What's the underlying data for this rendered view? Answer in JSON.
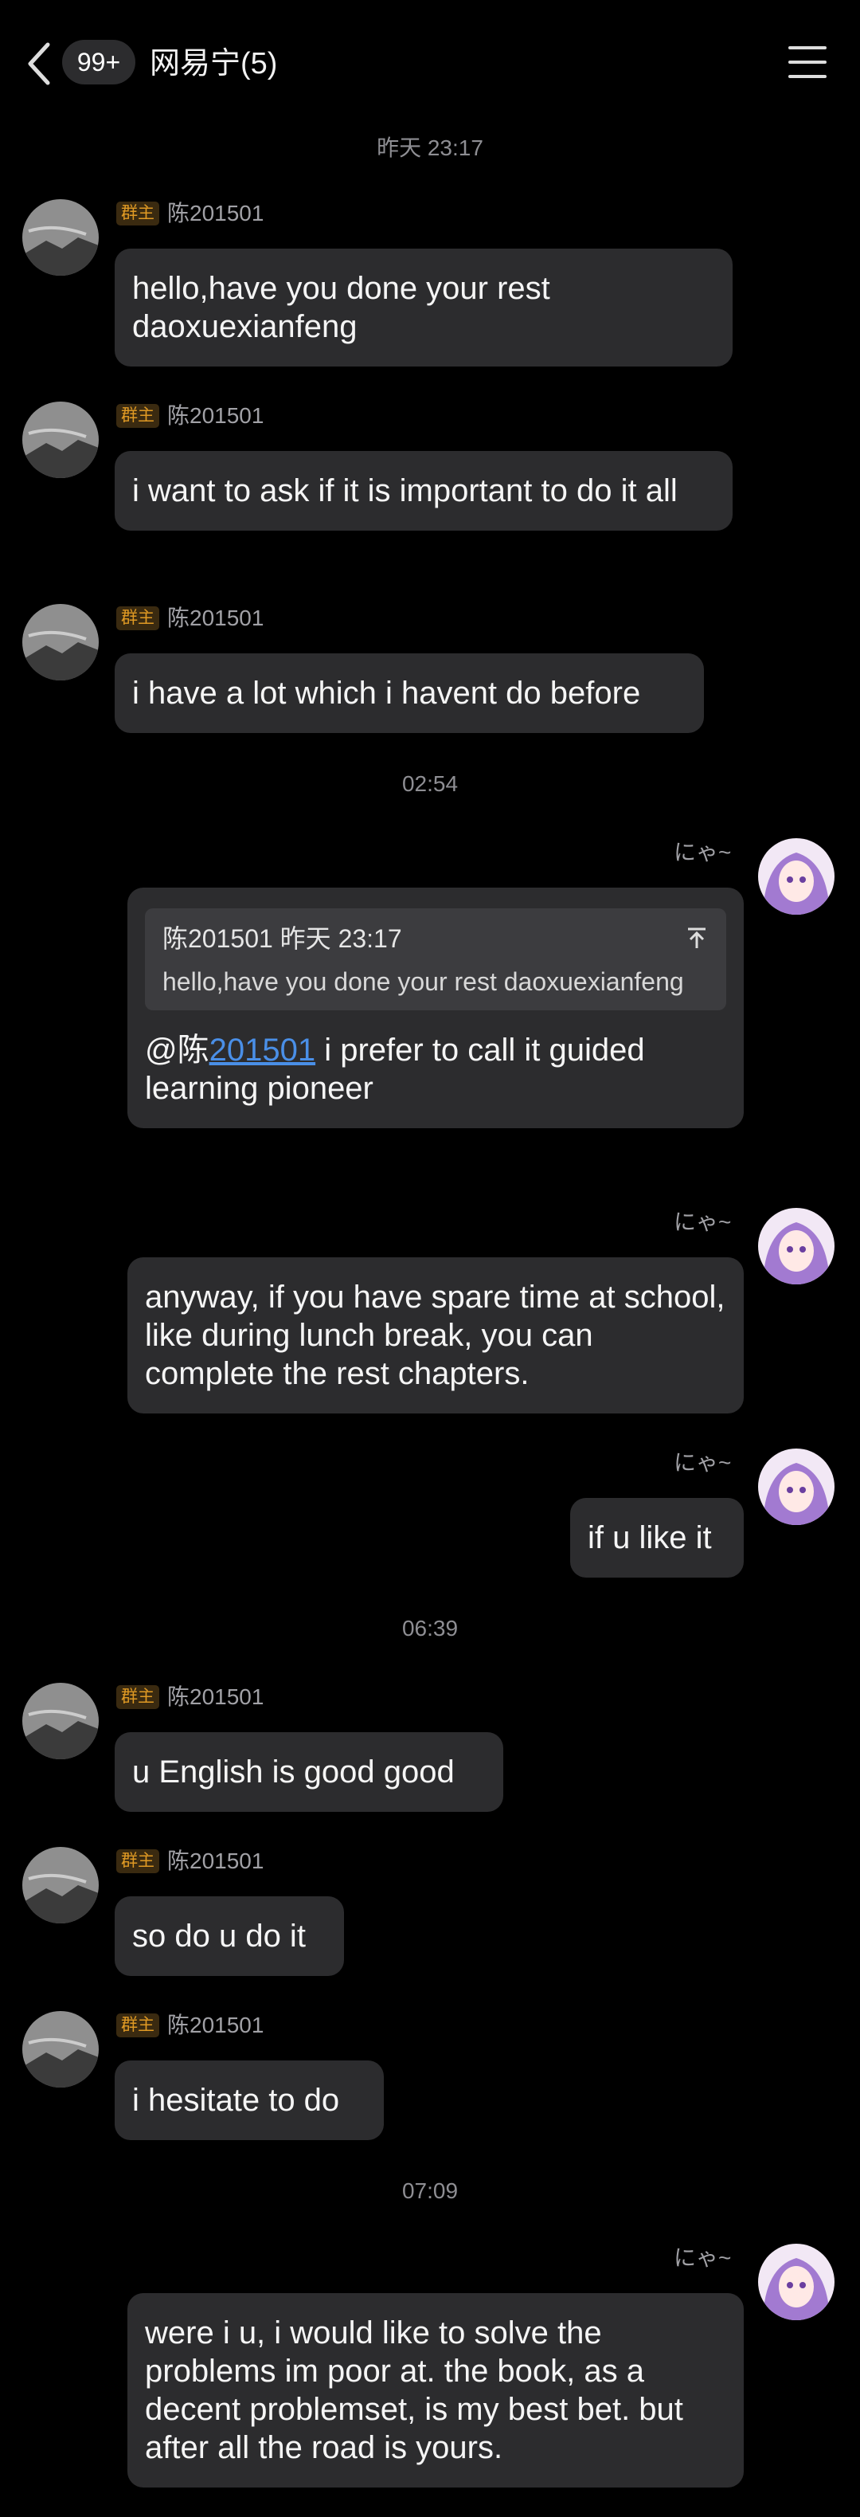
{
  "header": {
    "unread_badge": "99+",
    "title": "网易宁(5)"
  },
  "timestamps": [
    "昨天 23:17",
    "02:54",
    "06:39",
    "07:09"
  ],
  "sender_left": {
    "name": "陈201501",
    "role_tag": "群主"
  },
  "sender_right": {
    "name": "にゃ~"
  },
  "messages": [
    {
      "text": "hello,have you done your rest daoxuexianfeng"
    },
    {
      "text": "i want to ask if it is important to do it all"
    },
    {
      "text": "i have a lot which i havent do before"
    },
    {
      "quote_header": "陈201501 昨天 23:17",
      "quote_text": "hello,have you done your rest daoxuexianfeng",
      "mention_prefix": "@陈",
      "mention_link": "201501",
      "text": " i prefer to call it guided learning pioneer"
    },
    {
      "text": "anyway, if you have spare time at school, like during lunch break, you can complete the rest chapters."
    },
    {
      "text": "if u like it"
    },
    {
      "text": "u English is good good"
    },
    {
      "text": "so do u do it"
    },
    {
      "text": "i hesitate to do"
    },
    {
      "text": "were i u, i would like to solve the problems im poor at. the book, as a decent problemset, is my best bet. but after all the road is yours."
    }
  ],
  "colors": {
    "background": "#000000",
    "bubble": "#2c2c2e",
    "tag": "#e09a24",
    "mention": "#4a8fe7"
  }
}
